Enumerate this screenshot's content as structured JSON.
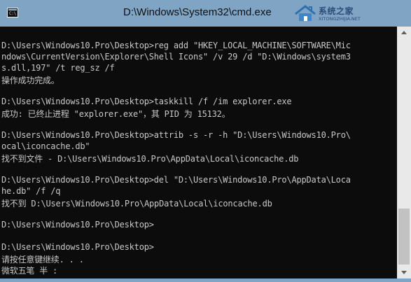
{
  "window": {
    "title": "D:\\Windows\\System32\\cmd.exe",
    "icon_text": "C:\\",
    "icon": "console-icon"
  },
  "watermark": {
    "name": "系统之家",
    "url": "XITONGZHIJIA.NET"
  },
  "console": {
    "lines": [
      "",
      "D:\\Users\\Windows10.Pro\\Desktop>reg add \"HKEY_LOCAL_MACHINE\\SOFTWARE\\Mic",
      "ndows\\CurrentVersion\\Explorer\\Shell Icons\" /v 29 /d \"D:\\Windows\\system3",
      "s.dll,197\" /t reg_sz /f",
      "操作成功完成。",
      "",
      "D:\\Users\\Windows10.Pro\\Desktop>taskkill /f /im explorer.exe",
      "成功: 已终止进程 \"explorer.exe\"，其 PID 为 15132。",
      "",
      "D:\\Users\\Windows10.Pro\\Desktop>attrib -s -r -h \"D:\\Users\\Windows10.Pro\\",
      "ocal\\iconcache.db\"",
      "找不到文件 - D:\\Users\\Windows10.Pro\\AppData\\Local\\iconcache.db",
      "",
      "D:\\Users\\Windows10.Pro\\Desktop>del \"D:\\Users\\Windows10.Pro\\AppData\\Loca",
      "he.db\" /f /q",
      "找不到 D:\\Users\\Windows10.Pro\\AppData\\Local\\iconcache.db",
      "",
      "D:\\Users\\Windows10.Pro\\Desktop>",
      "",
      "D:\\Users\\Windows10.Pro\\Desktop>",
      "请按任意键继续. . .",
      "微软五笔 半 :"
    ]
  },
  "colors": {
    "titlebar": "#7fa4c4",
    "console_bg": "#0c0c0c",
    "console_text": "#c8c8c8",
    "scrollbar": "#e9e9e9",
    "watermark": "#2f4b7a"
  }
}
